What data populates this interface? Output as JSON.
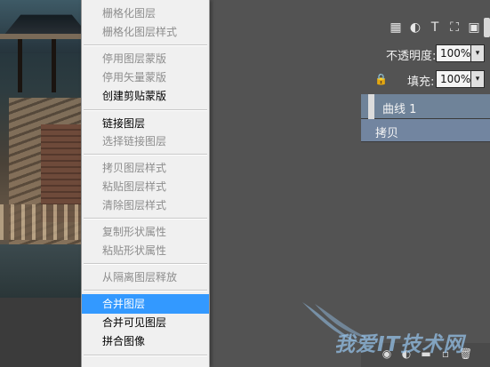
{
  "layers_panel": {
    "opacity_label": "不透明度:",
    "opacity_value": "100%",
    "fill_label": "填充:",
    "fill_value": "100%",
    "layers": [
      {
        "name": "曲线 1",
        "selected": true
      },
      {
        "name": "拷贝",
        "selected": true
      }
    ],
    "filter_icons": [
      "pixel-filter-icon",
      "adjustment-filter-icon",
      "type-filter-icon",
      "shape-filter-icon",
      "smart-object-filter-icon",
      "filter-toggle-icon"
    ],
    "accent_color": "#6f8399"
  },
  "context_menu": {
    "items": [
      {
        "label": "栅格化图层",
        "enabled": false
      },
      {
        "label": "栅格化图层样式",
        "enabled": false
      },
      {
        "label": "停用图层蒙版",
        "enabled": false
      },
      {
        "label": "停用矢量蒙版",
        "enabled": false
      },
      {
        "label": "创建剪贴蒙版",
        "enabled": true
      },
      {
        "label": "链接图层",
        "enabled": true
      },
      {
        "label": "选择链接图层",
        "enabled": false
      },
      {
        "label": "拷贝图层样式",
        "enabled": false
      },
      {
        "label": "粘贴图层样式",
        "enabled": false
      },
      {
        "label": "清除图层样式",
        "enabled": false
      },
      {
        "label": "复制形状属性",
        "enabled": false
      },
      {
        "label": "粘贴形状属性",
        "enabled": false
      },
      {
        "label": "从隔离图层释放",
        "enabled": false
      },
      {
        "label": "合并图层",
        "enabled": true,
        "highlighted": true
      },
      {
        "label": "合并可见图层",
        "enabled": true
      },
      {
        "label": "拼合图像",
        "enabled": true
      }
    ],
    "highlight_color": "#3399ff"
  },
  "watermark": {
    "text": "我爱IT技术网"
  }
}
